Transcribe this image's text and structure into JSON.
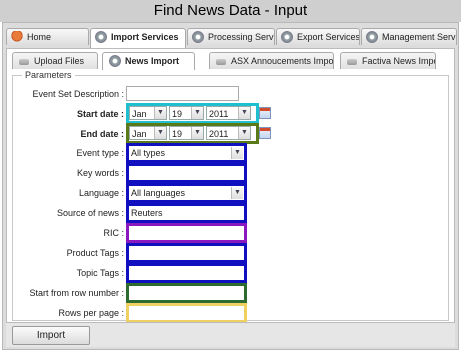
{
  "window": {
    "title": "Find News Data - Input"
  },
  "top_tabs": [
    {
      "label": "Home",
      "icon": "home-icon"
    },
    {
      "label": "Import Services",
      "icon": "gear-icon",
      "active": true
    },
    {
      "label": "Processing Servi",
      "icon": "gear-icon"
    },
    {
      "label": "Export Services",
      "icon": "gear-icon"
    },
    {
      "label": "Management Servi",
      "icon": "gear-icon"
    }
  ],
  "sub_tabs": [
    {
      "label": "Upload Files"
    },
    {
      "label": "News Import",
      "active": true
    },
    {
      "label": "ASX Annoucements Import"
    },
    {
      "label": "Factiva News Import"
    }
  ],
  "form": {
    "legend": "Parameters",
    "event_set_description": {
      "label": "Event Set Description :",
      "value": ""
    },
    "start_date": {
      "label": "Start date :",
      "month": "Jan",
      "day": "19",
      "year": "2011"
    },
    "end_date": {
      "label": "End date :",
      "month": "Jan",
      "day": "19",
      "year": "2011"
    },
    "event_type": {
      "label": "Event type :",
      "value": "All types"
    },
    "key_words": {
      "label": "Key words :",
      "value": ""
    },
    "language": {
      "label": "Language :",
      "value": "All languages"
    },
    "source_of_news": {
      "label": "Source of news :",
      "value": "Reuters"
    },
    "ric": {
      "label": "RIC :",
      "value": ""
    },
    "product_tags": {
      "label": "Product Tags :",
      "value": ""
    },
    "topic_tags": {
      "label": "Topic Tags :",
      "value": ""
    },
    "start_from_row": {
      "label": "Start from row number :",
      "value": ""
    },
    "rows_per_page": {
      "label": "Rows per page :",
      "value": ""
    }
  },
  "buttons": {
    "import_label": "Import"
  },
  "colors": {
    "start_date_highlight": "#1fbfcf",
    "end_date_highlight": "#5a7a1a",
    "ric_highlight": "#8a1ac0",
    "start_row_highlight": "#2e6b2e",
    "rows_per_page_highlight": "#f0d060",
    "field_highlight": "#1010c0"
  }
}
